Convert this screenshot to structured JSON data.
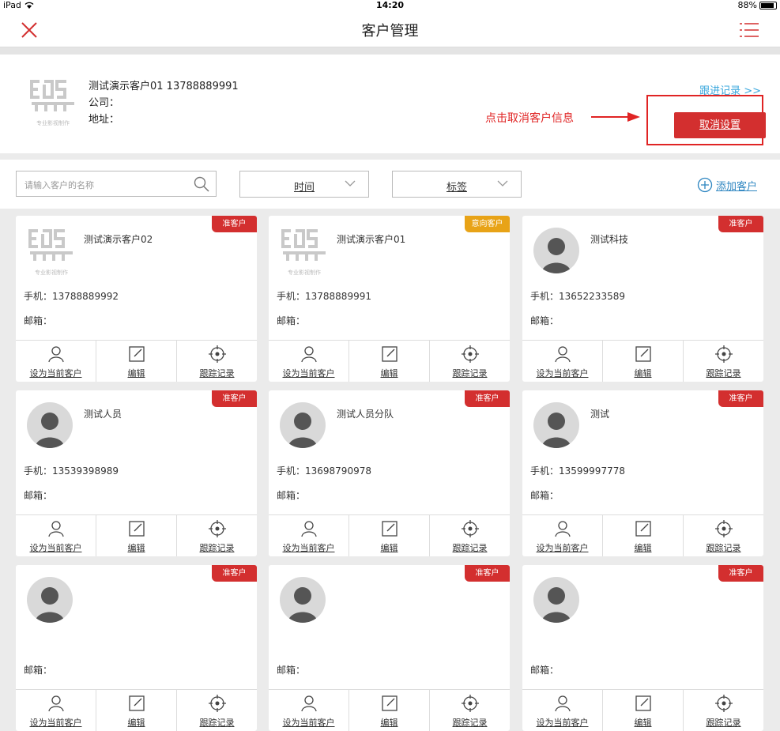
{
  "status_bar": {
    "device": "iPad",
    "time": "14:20",
    "battery": "88%",
    "battery_level": 0.88
  },
  "nav": {
    "title": "客户管理"
  },
  "customer": {
    "logo_subtext": "专业影视制作",
    "line1": "测试演示客户01  13788889991",
    "company_label": "公司：",
    "address_label": "地址：",
    "follow_link": "跟进记录 >>",
    "cancel_button": "取消设置"
  },
  "annotation": {
    "text": "点击取消客户信息"
  },
  "filter": {
    "search_placeholder": "请输入客户的名称",
    "time_label": "时间",
    "tag_label": "标签",
    "add_customer": "添加客户"
  },
  "labels": {
    "phone_prefix": "手机：",
    "email_label": "邮箱：",
    "set_current": "设为当前客户",
    "edit": "编辑",
    "track": "跟踪记录"
  },
  "colors": {
    "accent_red": "#d32f2f",
    "badge_orange": "#e8a317",
    "link_blue": "#2e86c1"
  },
  "cards": [
    {
      "name": "测试演示客户02",
      "phone": "手机：13788889992",
      "badge": "准客户",
      "badge_color": "#d32f2f",
      "avatar": "logo"
    },
    {
      "name": "测试演示客户01",
      "phone": "手机：13788889991",
      "badge": "意向客户",
      "badge_color": "#e8a317",
      "avatar": "logo"
    },
    {
      "name": "测试科技",
      "phone": "手机：13652233589",
      "badge": "准客户",
      "badge_color": "#d32f2f",
      "avatar": "person"
    },
    {
      "name": "测试人员",
      "phone": "手机：13539398989",
      "badge": "准客户",
      "badge_color": "#d32f2f",
      "avatar": "person"
    },
    {
      "name": "测试人员分队",
      "phone": "手机：13698790978",
      "badge": "准客户",
      "badge_color": "#d32f2f",
      "avatar": "person"
    },
    {
      "name": "测试",
      "phone": "手机：13599997778",
      "badge": "准客户",
      "badge_color": "#d32f2f",
      "avatar": "person"
    },
    {
      "name": "",
      "phone": "",
      "badge": "准客户",
      "badge_color": "#d32f2f",
      "avatar": "person"
    },
    {
      "name": "",
      "phone": "",
      "badge": "准客户",
      "badge_color": "#d32f2f",
      "avatar": "person"
    },
    {
      "name": "",
      "phone": "",
      "badge": "准客户",
      "badge_color": "#d32f2f",
      "avatar": "person"
    }
  ]
}
